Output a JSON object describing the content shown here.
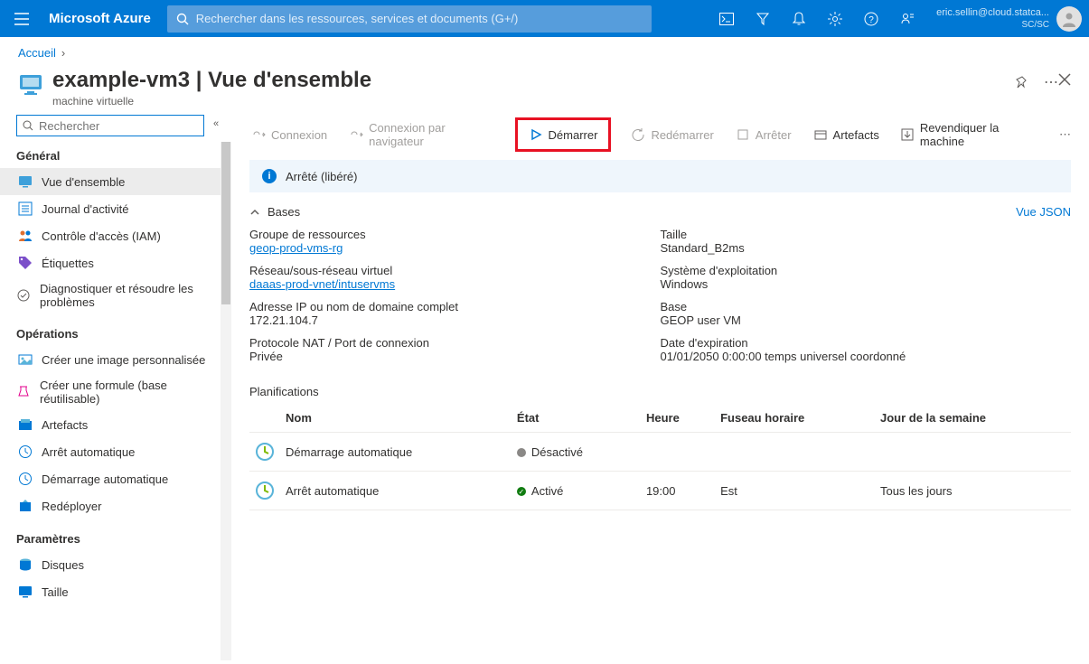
{
  "topbar": {
    "brand": "Microsoft Azure",
    "search_placeholder": "Rechercher dans les ressources, services et documents (G+/)",
    "user_email": "eric.sellin@cloud.statca...",
    "user_dir": "SC/SC"
  },
  "breadcrumb": {
    "home": "Accueil"
  },
  "title": {
    "name": "example-vm3",
    "section": "Vue d'ensemble",
    "subtitle": "machine virtuelle"
  },
  "sidebar": {
    "search_placeholder": "Rechercher",
    "sections": {
      "general": "Général",
      "operations": "Opérations",
      "parameters": "Paramètres"
    },
    "items": {
      "overview": "Vue d'ensemble",
      "activity": "Journal d'activité",
      "iam": "Contrôle d'accès (IAM)",
      "tags": "Étiquettes",
      "diagnose": "Diagnostiquer et résoudre les problèmes",
      "createimg": "Créer une image personnalisée",
      "createformula": "Créer une formule (base réutilisable)",
      "artefacts": "Artefacts",
      "autoshutdown": "Arrêt automatique",
      "autostart": "Démarrage automatique",
      "redeploy": "Redéployer",
      "disks": "Disques",
      "size": "Taille"
    }
  },
  "toolbar": {
    "connect": "Connexion",
    "browser_connect": "Connexion par navigateur",
    "start": "Démarrer",
    "restart": "Redémarrer",
    "stop": "Arrêter",
    "artefacts": "Artefacts",
    "claim": "Revendiquer la machine"
  },
  "banner": {
    "status": "Arrêté (libéré)"
  },
  "bases": {
    "header": "Bases",
    "json_link": "Vue JSON",
    "left": [
      {
        "label": "Groupe de ressources",
        "value": "geop-prod-vms-rg",
        "link": true
      },
      {
        "label": "Réseau/sous-réseau virtuel",
        "value": "daaas-prod-vnet/intuservms",
        "link": true
      },
      {
        "label": "Adresse IP ou nom de domaine complet",
        "value": "172.21.104.7",
        "link": false
      },
      {
        "label": "Protocole NAT / Port de connexion",
        "value": "Privée",
        "link": false
      }
    ],
    "right": [
      {
        "label": "Taille",
        "value": "Standard_B2ms"
      },
      {
        "label": "Système d'exploitation",
        "value": "Windows"
      },
      {
        "label": "Base",
        "value": "GEOP user VM"
      },
      {
        "label": "Date d'expiration",
        "value": "01/01/2050 0:00:00 temps universel coordonné"
      }
    ]
  },
  "schedules": {
    "title": "Planifications",
    "headers": {
      "name": "Nom",
      "state": "État",
      "time": "Heure",
      "tz": "Fuseau horaire",
      "dow": "Jour de la semaine"
    },
    "rows": [
      {
        "name": "Démarrage automatique",
        "state": "Désactivé",
        "state_kind": "off",
        "time": "",
        "tz": "",
        "dow": ""
      },
      {
        "name": "Arrêt automatique",
        "state": "Activé",
        "state_kind": "on",
        "time": "19:00",
        "tz": "Est",
        "dow": "Tous les jours"
      }
    ]
  }
}
